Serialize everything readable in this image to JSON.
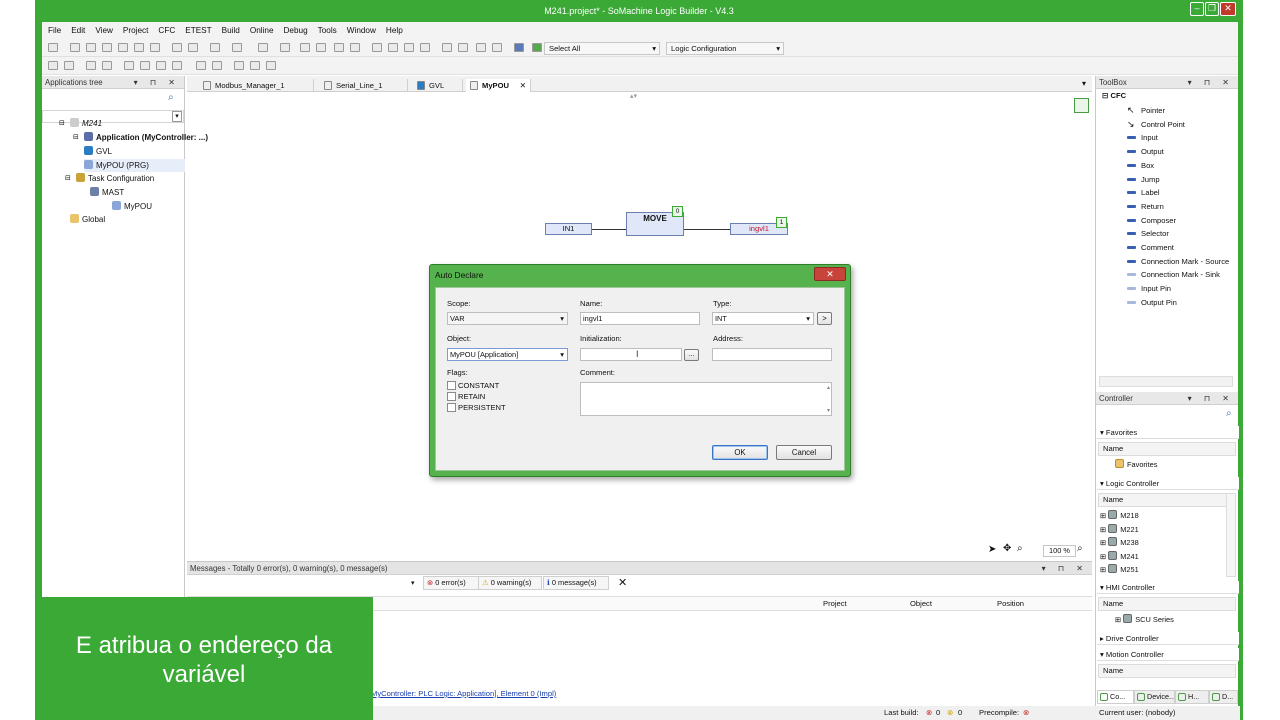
{
  "window": {
    "title": "M241.project* - SoMachine Logic Builder - V4.3"
  },
  "menu": [
    "File",
    "Edit",
    "View",
    "Project",
    "CFC",
    "ETEST",
    "Build",
    "Online",
    "Debug",
    "Tools",
    "Window",
    "Help"
  ],
  "toolbar": {
    "select_all": "Select All",
    "logic_config": "Logic Configuration"
  },
  "apps_tree": {
    "title": "Applications tree",
    "items": [
      {
        "label": "M241",
        "italic": true
      },
      {
        "label": "Application (MyController: ...)",
        "bold": true
      },
      {
        "label": "GVL"
      },
      {
        "label": "MyPOU (PRG)"
      },
      {
        "label": "Task Configuration"
      },
      {
        "label": "MAST"
      },
      {
        "label": "MyPOU"
      },
      {
        "label": "Global"
      }
    ]
  },
  "tabs": [
    "Modbus_Manager_1",
    "Serial_Line_1",
    "GVL",
    "MyPOU"
  ],
  "cfc": {
    "input": "IN1",
    "block": "MOVE",
    "block_index": "0",
    "output": "ingvl1",
    "output_index": "1"
  },
  "dialog": {
    "title": "Auto Declare",
    "scope_label": "Scope:",
    "scope": "VAR",
    "name_label": "Name:",
    "name": "ingvl1",
    "type_label": "Type:",
    "type": "INT",
    "object_label": "Object:",
    "object": "MyPOU [Application]",
    "init_label": "Initialization:",
    "init": "",
    "address_label": "Address:",
    "address": "",
    "flags_label": "Flags:",
    "flags": [
      "CONSTANT",
      "RETAIN",
      "PERSISTENT"
    ],
    "comment_label": "Comment:",
    "ok": "OK",
    "cancel": "Cancel",
    "more_btn": "...",
    "type_btn": ">"
  },
  "zoom": "100 %",
  "messages": {
    "title": "Messages - Totally 0 error(s), 0 warning(s), 0 message(s)",
    "errors": "0 error(s)",
    "warnings": "0 warning(s)",
    "msgs": "0 message(s)",
    "cols": [
      "Project",
      "Object",
      "Position"
    ]
  },
  "toolbox": {
    "title": "ToolBox",
    "group": "CFC",
    "items": [
      "Pointer",
      "Control Point",
      "Input",
      "Output",
      "Box",
      "Jump",
      "Label",
      "Return",
      "Composer",
      "Selector",
      "Comment",
      "Connection Mark - Source",
      "Connection Mark - Sink",
      "Input Pin",
      "Output Pin"
    ]
  },
  "controller": {
    "title": "Controller",
    "favorites": "Favorites",
    "name_col": "Name",
    "favorites_folder": "Favorites",
    "logic": "Logic Controller",
    "logic_items": [
      "M218",
      "M221",
      "M238",
      "M241",
      "M251"
    ],
    "hmi": "HMI Controller",
    "hmi_items": [
      "SCU Series"
    ],
    "drive": "Drive Controller",
    "motion": "Motion Controller",
    "bottom_tabs": [
      "Co...",
      "Device...",
      "H...",
      "D..."
    ]
  },
  "status": {
    "link": "MyController: PLC Logic: Application], Element 0 (Impl)",
    "last_build": "Last build:",
    "lb_err": "0",
    "lb_warn": "0",
    "precompile": "Precompile:",
    "user": "Current user: (nobody)"
  },
  "caption": "E atribua o endereço da variável",
  "colors": {
    "accent": "#3aa935",
    "link": "#1a3fb0",
    "output_text": "#c0162b"
  }
}
